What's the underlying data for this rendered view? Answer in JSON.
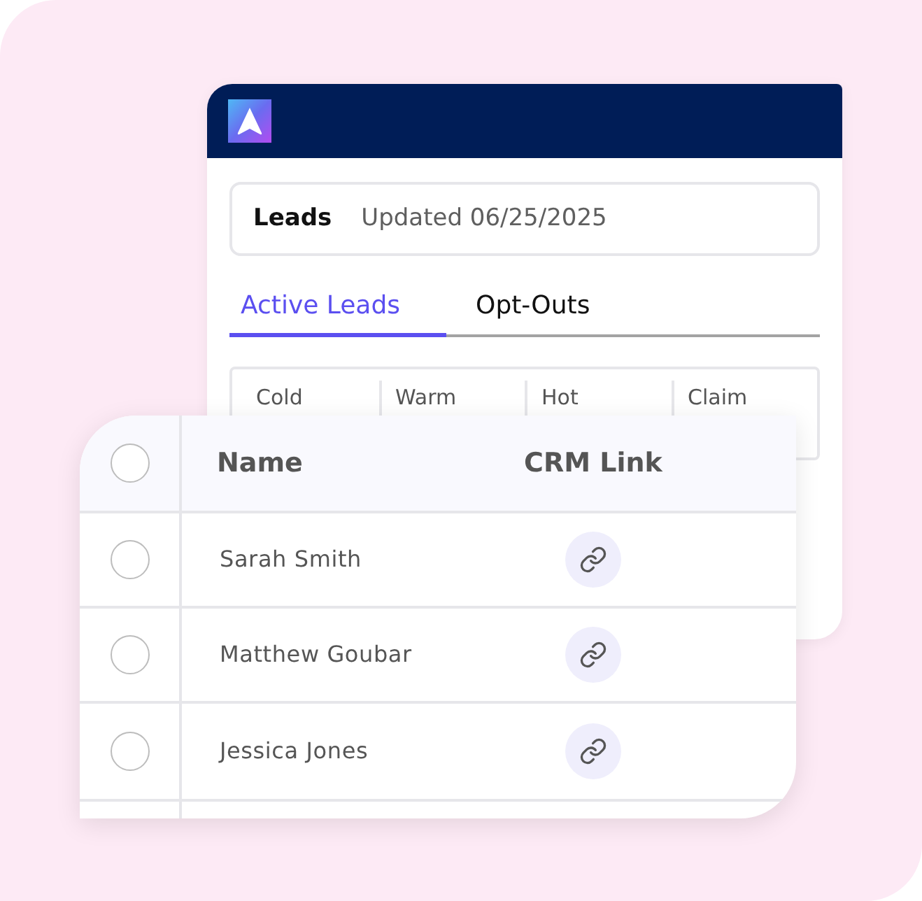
{
  "summary": {
    "title": "Leads",
    "updated": "Updated 06/25/2025"
  },
  "tabs": [
    {
      "label": "Active Leads",
      "selected": true
    },
    {
      "label": "Opt-Outs",
      "selected": false
    }
  ],
  "stats": [
    {
      "label": "Cold"
    },
    {
      "label": "Warm"
    },
    {
      "label": "Hot"
    },
    {
      "label": "Claim"
    }
  ],
  "table": {
    "columns": [
      "Name",
      "CRM Link"
    ],
    "header_checked": false,
    "rows": [
      {
        "name": "Sarah Smith",
        "checked": false
      },
      {
        "name": "Matthew Goubar",
        "checked": false
      },
      {
        "name": "Jessica Jones",
        "checked": false
      }
    ]
  }
}
